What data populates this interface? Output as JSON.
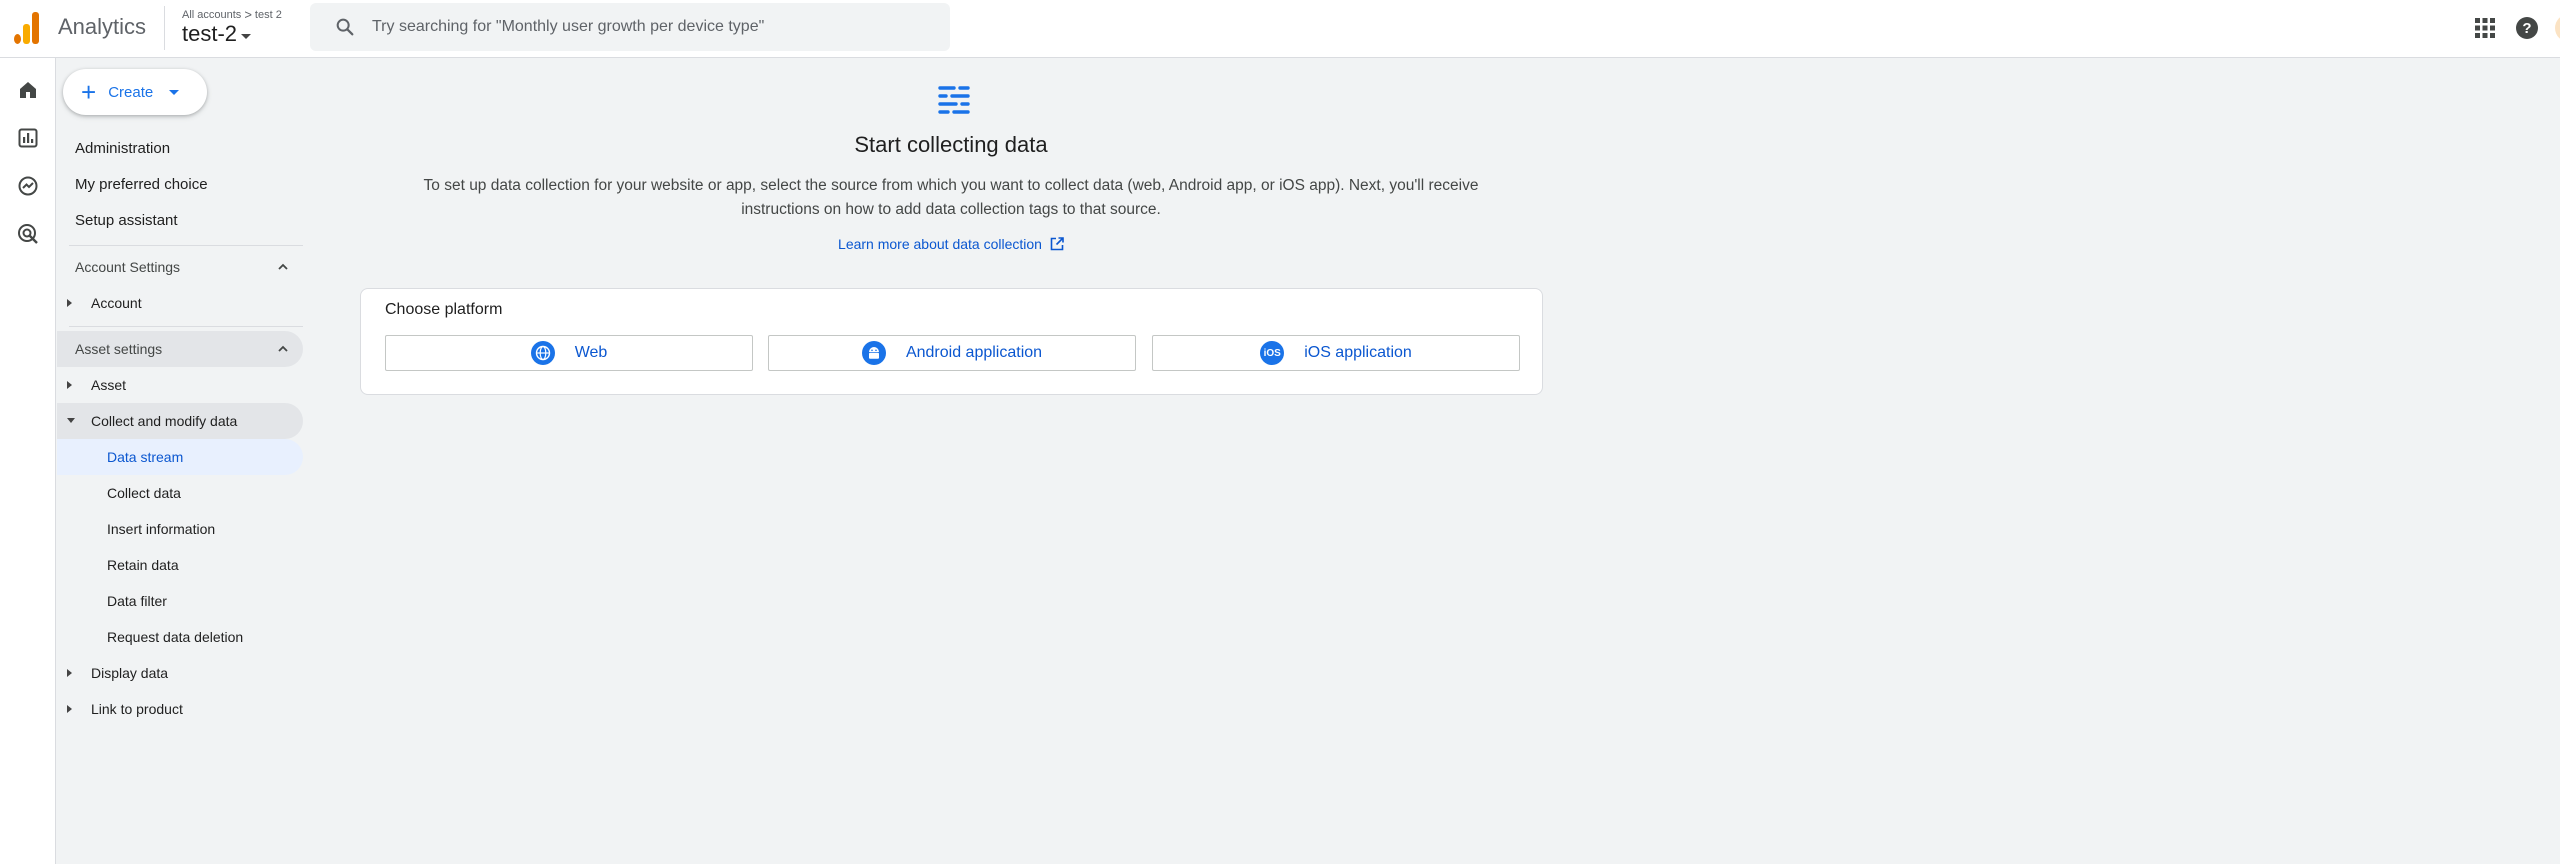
{
  "header": {
    "app_title": "Analytics",
    "breadcrumb": {
      "root": "All accounts",
      "separator": ">",
      "account": "test 2"
    },
    "property_name": "test-2",
    "search_placeholder": "Try searching for \"Monthly user growth per device type\"",
    "icons": [
      "apps-grid-icon",
      "help-icon",
      "account-avatar"
    ]
  },
  "rail": {
    "items": [
      "home-icon",
      "reports-icon",
      "explore-icon",
      "advertising-icon"
    ]
  },
  "sidenav": {
    "create_label": "Create",
    "top_links": [
      "Administration",
      "My preferred choice",
      "Setup assistant"
    ],
    "account_settings": {
      "header": "Account Settings",
      "items": [
        "Account"
      ]
    },
    "asset_settings": {
      "header": "Asset settings",
      "asset": "Asset",
      "collect_modify": "Collect and modify data",
      "sub_items": [
        "Data stream",
        "Collect data",
        "Insert information",
        "Retain data",
        "Data filter",
        "Request data deletion"
      ],
      "selected_sub_item": "Data stream",
      "more": [
        "Display data",
        "Link to product"
      ]
    }
  },
  "main": {
    "title": "Start collecting data",
    "description": "To set up data collection for your website or app, select the source from which you want to collect data (web, Android app, or iOS app). Next, you'll receive instructions on how to add data collection tags to that source.",
    "learn_more": "Learn more about data collection",
    "card": {
      "title": "Choose platform",
      "platforms": [
        {
          "label": "Web",
          "icon": "globe-icon"
        },
        {
          "label": "Android application",
          "icon": "android-icon"
        },
        {
          "label": "iOS application",
          "icon": "ios-icon",
          "icon_text": "iOS"
        }
      ]
    }
  },
  "colors": {
    "accent": "#0b57d0",
    "brand_orange": "#e37400",
    "brand_yellow": "#f9ab00",
    "selected_bg": "#e8f0fe"
  }
}
